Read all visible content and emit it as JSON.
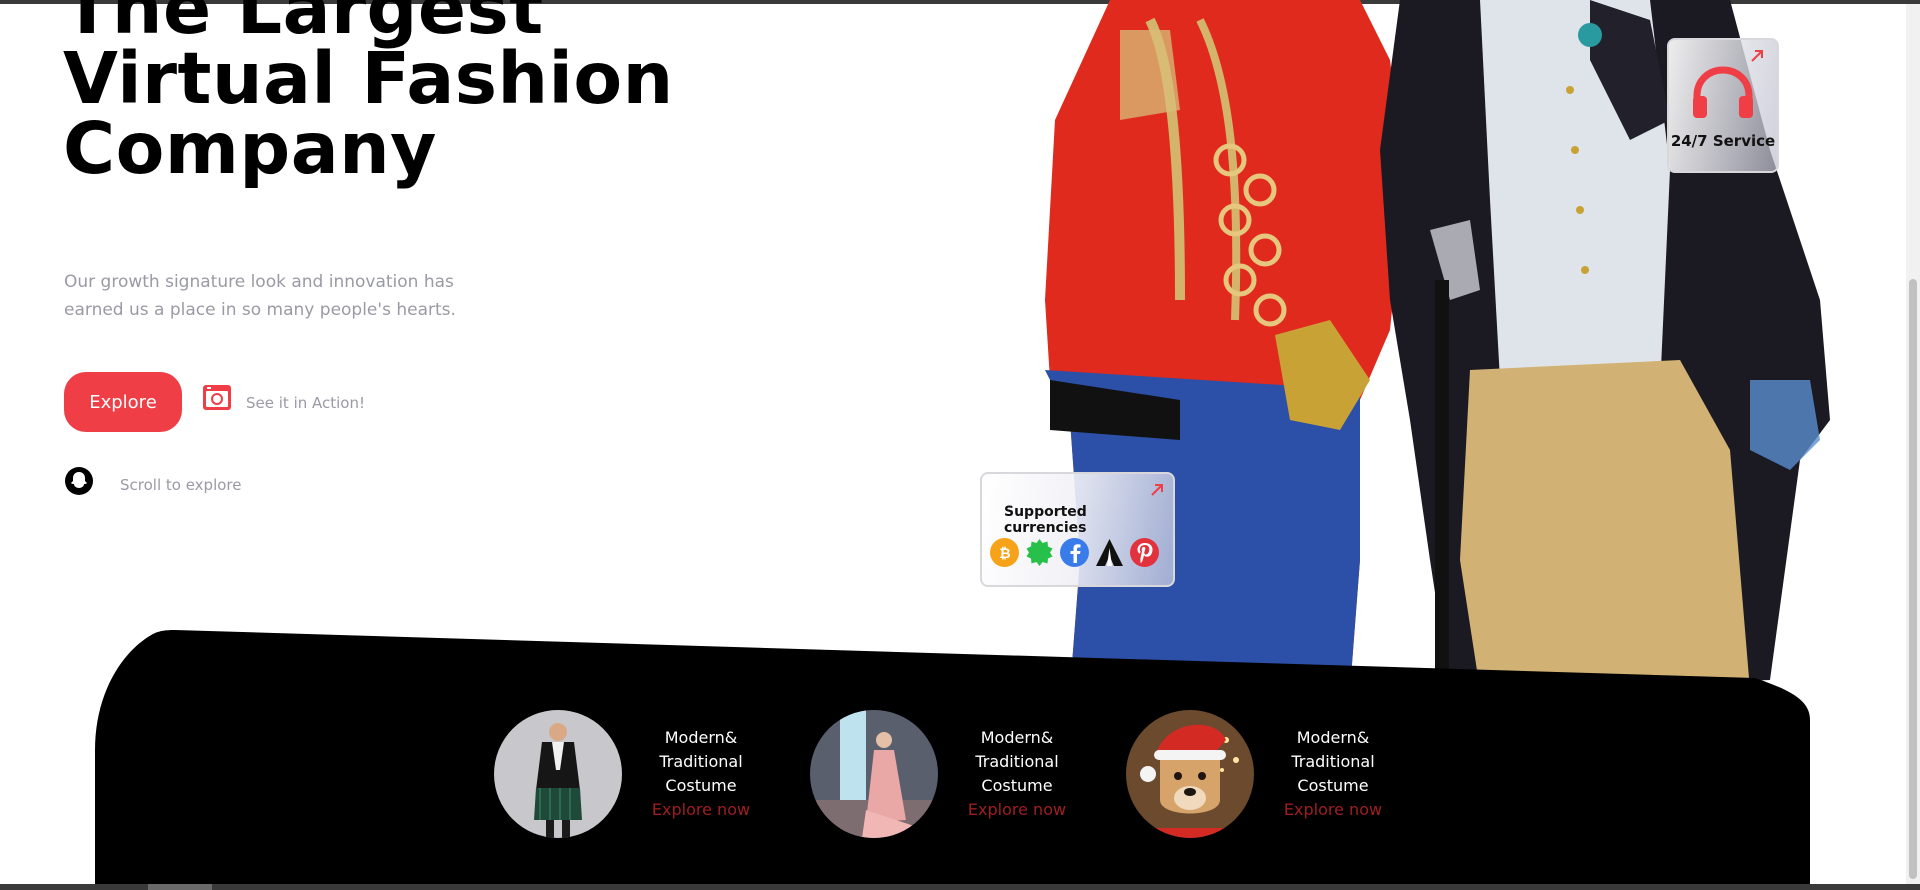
{
  "hero": {
    "title_line1": "The Largest",
    "title_line2": "Virtual Fashion",
    "title_line3": "Company",
    "description": "Our growth signature look and innovation has earned us a place in so many people's hearts.",
    "explore_button": "Explore",
    "action_link": "See it in Action!",
    "scroll_hint": "Scroll to explore"
  },
  "service_card": {
    "label": "24/7 Service",
    "icon": "headphone-icon"
  },
  "currency_card": {
    "label": "Supported currencies",
    "coins": [
      "bitcoin-icon",
      "badge-icon",
      "facebook-icon",
      "triangle-icon",
      "pinterest-icon"
    ]
  },
  "products": [
    {
      "title_line1": "Modern&",
      "title_line2": "Traditional Costume",
      "cta": "Explore now"
    },
    {
      "title_line1": "Modern&",
      "title_line2": "Traditional Costume",
      "cta": "Explore now"
    },
    {
      "title_line1": "Modern&",
      "title_line2": "Traditional Costume",
      "cta": "Explore now"
    }
  ],
  "colors": {
    "accent": "#ef3e45",
    "muted_text": "#9a9aa6",
    "panel": "#000000",
    "explore_link": "#9e1e22"
  }
}
